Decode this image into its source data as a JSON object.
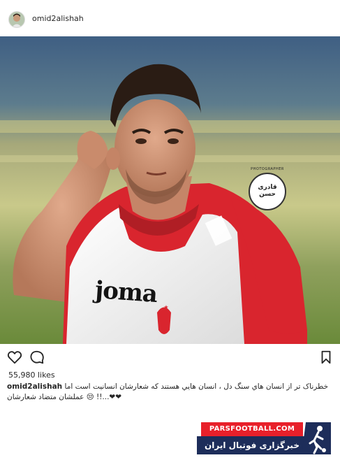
{
  "post": {
    "username": "omid2alishah",
    "likes": "55,980 likes",
    "caption_user": "omid2alishah",
    "caption_line1": "خطرناک تر از انسان هاي سنگ دل ، انسان هايي هستند که شعارشان انسانيت است اما",
    "caption_line2": "❤❤...!! 😒 عملشان متضاد شعارشان"
  },
  "photo": {
    "shirt_brand": "joma",
    "watermark_top": "PHOTOGRAPHER",
    "watermark_text": "قادری حسن"
  },
  "actions": {
    "like": "heart-icon",
    "comment": "comment-icon",
    "save": "bookmark-icon"
  },
  "banner": {
    "site": "PARSFOOTBALL.COM",
    "tagline": "خبرگزاری فوتبال ایران"
  },
  "colors": {
    "shirt_red": "#d9252e",
    "banner_red": "#e8202a",
    "banner_blue": "#1d2d5a"
  }
}
